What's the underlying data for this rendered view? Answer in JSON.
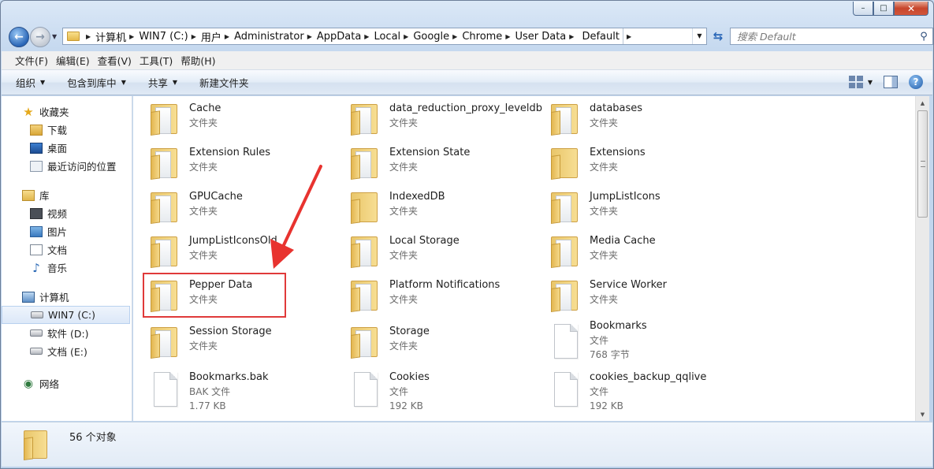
{
  "caption": {
    "minimize": "–",
    "maximize": "□",
    "close": "✕"
  },
  "address": {
    "crumbs": [
      "计算机",
      "WIN7 (C:)",
      "用户",
      "Administrator",
      "AppData",
      "Local",
      "Google",
      "Chrome",
      "User Data",
      "Default"
    ]
  },
  "search": {
    "placeholder": "搜索 Default"
  },
  "menu": [
    "文件(F)",
    "编辑(E)",
    "查看(V)",
    "工具(T)",
    "帮助(H)"
  ],
  "toolbar": {
    "organize": "组织",
    "include_library": "包含到库中",
    "share": "共享",
    "new_folder": "新建文件夹"
  },
  "sidebar": {
    "favorites": {
      "label": "收藏夹",
      "items": [
        "下载",
        "桌面",
        "最近访问的位置"
      ]
    },
    "libraries": {
      "label": "库",
      "items": [
        "视频",
        "图片",
        "文档",
        "音乐"
      ]
    },
    "computer": {
      "label": "计算机",
      "items": [
        "WIN7 (C:)",
        "软件 (D:)",
        "文档 (E:)"
      ]
    },
    "network": {
      "label": "网络"
    }
  },
  "files": [
    {
      "name": "Cache",
      "type": "文件夹"
    },
    {
      "name": "data_reduction_proxy_leveldb",
      "type": "文件夹"
    },
    {
      "name": "databases",
      "type": "文件夹"
    },
    {
      "name": "Extension Rules",
      "type": "文件夹"
    },
    {
      "name": "Extension State",
      "type": "文件夹"
    },
    {
      "name": "Extensions",
      "type": "文件夹"
    },
    {
      "name": "GPUCache",
      "type": "文件夹"
    },
    {
      "name": "IndexedDB",
      "type": "文件夹"
    },
    {
      "name": "JumpListIcons",
      "type": "文件夹"
    },
    {
      "name": "JumpListIconsOld",
      "type": "文件夹"
    },
    {
      "name": "Local Storage",
      "type": "文件夹"
    },
    {
      "name": "Media Cache",
      "type": "文件夹"
    },
    {
      "name": "Pepper Data",
      "type": "文件夹"
    },
    {
      "name": "Platform Notifications",
      "type": "文件夹"
    },
    {
      "name": "Service Worker",
      "type": "文件夹"
    },
    {
      "name": "Session Storage",
      "type": "文件夹"
    },
    {
      "name": "Storage",
      "type": "文件夹"
    },
    {
      "name": "Bookmarks",
      "type": "文件",
      "size": "768 字节"
    },
    {
      "name": "Bookmarks.bak",
      "type": "BAK 文件",
      "size": "1.77 KB"
    },
    {
      "name": "Cookies",
      "type": "文件",
      "size": "192 KB"
    },
    {
      "name": "cookies_backup_qqlive",
      "type": "文件",
      "size": "192 KB"
    }
  ],
  "status": {
    "count": "56 个对象"
  },
  "colors": {
    "highlight": "#e03a3a",
    "accent": "#2a66b7"
  }
}
